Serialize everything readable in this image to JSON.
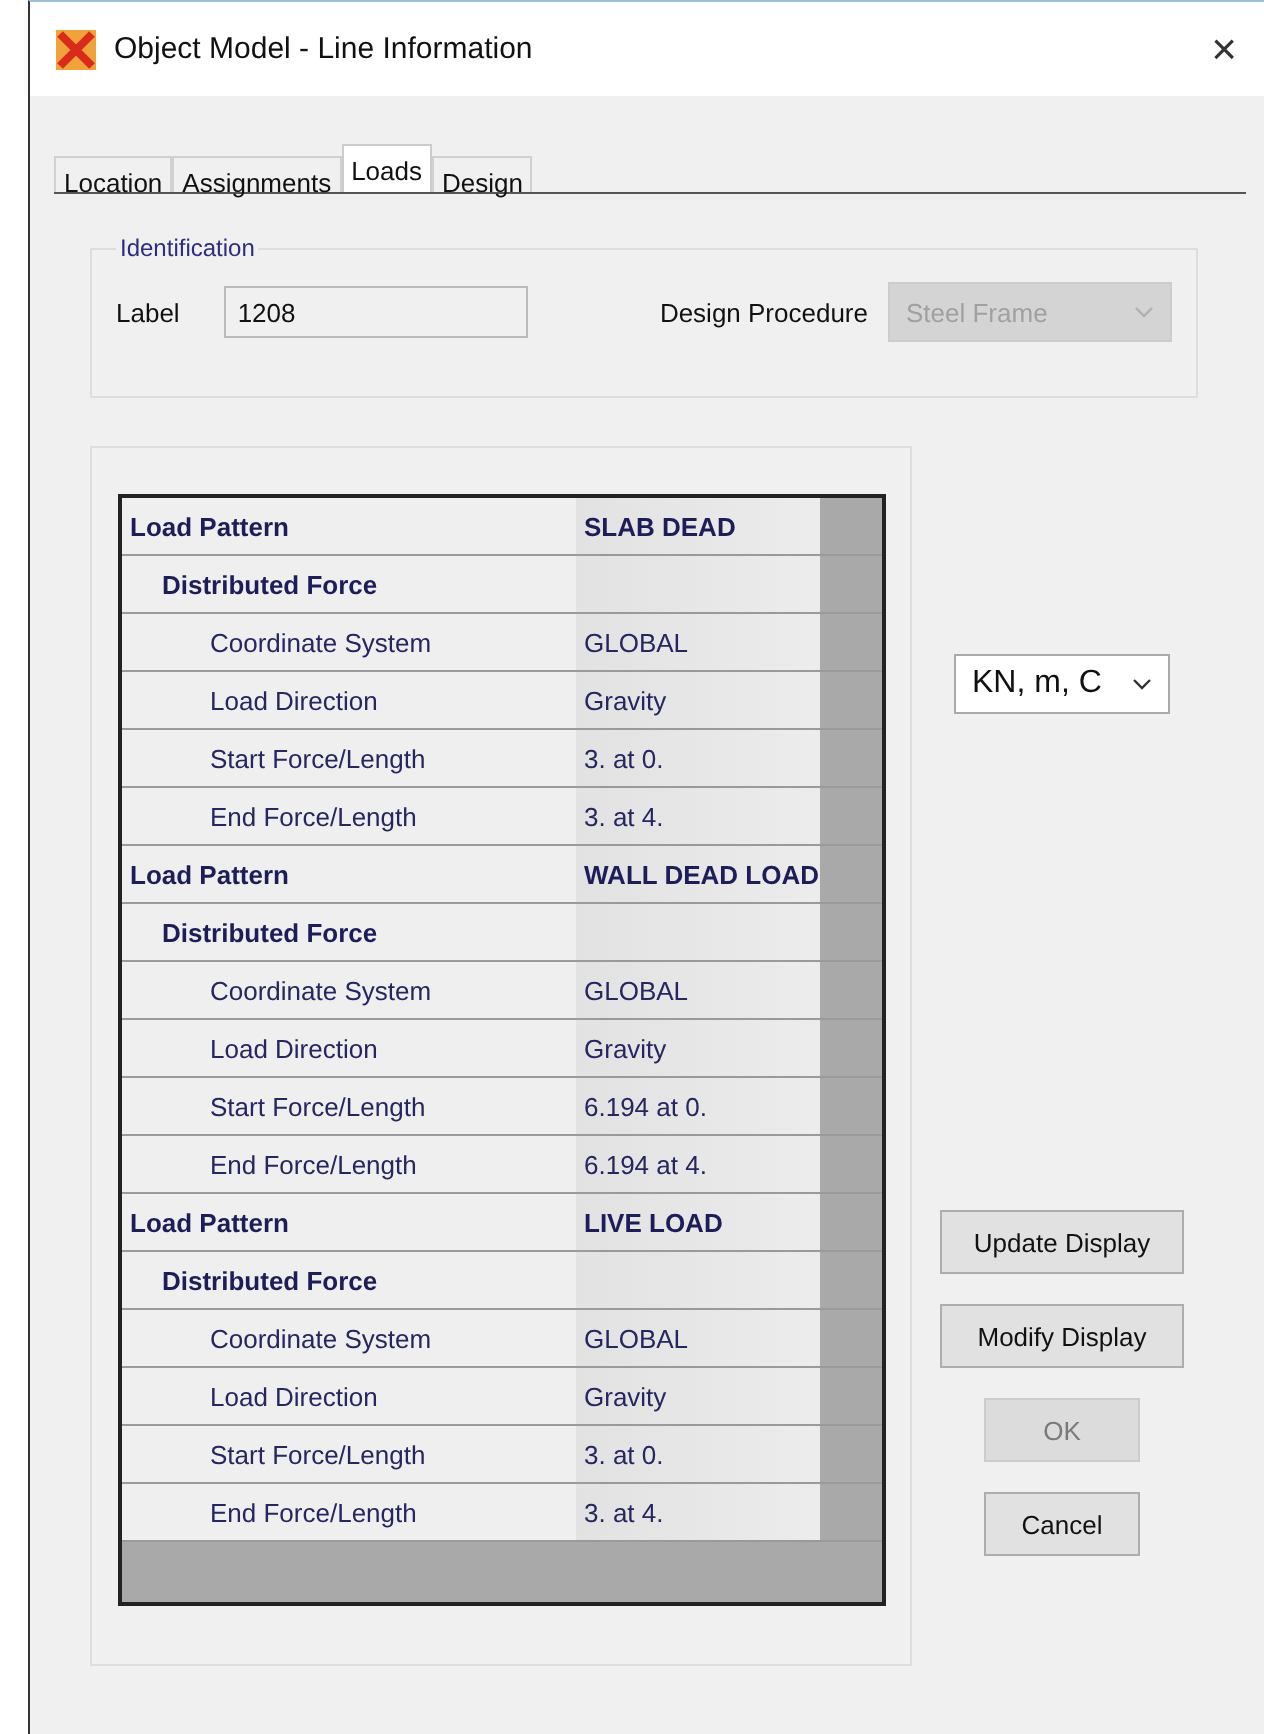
{
  "window": {
    "title": "Object Model - Line Information",
    "close": "×"
  },
  "tabs": [
    {
      "label": "Location",
      "selected": false
    },
    {
      "label": "Assignments",
      "selected": false
    },
    {
      "label": "Loads",
      "selected": true
    },
    {
      "label": "Design",
      "selected": false
    }
  ],
  "identification": {
    "title": "Identification",
    "label_caption": "Label",
    "label_value": "1208",
    "procedure_caption": "Design Procedure",
    "procedure_value": "Steel Frame",
    "procedure_disabled": true
  },
  "table": {
    "rows": [
      {
        "kind": "pattern",
        "label": "Load Pattern",
        "value": "SLAB DEAD"
      },
      {
        "kind": "group",
        "label": "Distributed Force",
        "value": ""
      },
      {
        "kind": "property",
        "label": "Coordinate System",
        "value": "GLOBAL"
      },
      {
        "kind": "property",
        "label": "Load Direction",
        "value": "Gravity"
      },
      {
        "kind": "property",
        "label": "Start Force/Length",
        "value": "3. at 0."
      },
      {
        "kind": "property",
        "label": "End Force/Length",
        "value": "3. at 4."
      },
      {
        "kind": "pattern",
        "label": "Load Pattern",
        "value": "WALL DEAD LOAD"
      },
      {
        "kind": "group",
        "label": "Distributed Force",
        "value": ""
      },
      {
        "kind": "property",
        "label": "Coordinate System",
        "value": "GLOBAL"
      },
      {
        "kind": "property",
        "label": "Load Direction",
        "value": "Gravity"
      },
      {
        "kind": "property",
        "label": "Start Force/Length",
        "value": "6.194 at 0."
      },
      {
        "kind": "property",
        "label": "End Force/Length",
        "value": "6.194 at 4."
      },
      {
        "kind": "pattern",
        "label": "Load Pattern",
        "value": "LIVE LOAD"
      },
      {
        "kind": "group",
        "label": "Distributed Force",
        "value": ""
      },
      {
        "kind": "property",
        "label": "Coordinate System",
        "value": "GLOBAL"
      },
      {
        "kind": "property",
        "label": "Load Direction",
        "value": "Gravity"
      },
      {
        "kind": "property",
        "label": "Start Force/Length",
        "value": "3. at 0."
      },
      {
        "kind": "property",
        "label": "End Force/Length",
        "value": "3. at 4."
      }
    ]
  },
  "units": {
    "value": "KN, m, C"
  },
  "buttons": [
    {
      "label": "Update Display",
      "kind": "wide",
      "disabled": false
    },
    {
      "label": "Modify Display",
      "kind": "wide",
      "disabled": false
    },
    {
      "label": "OK",
      "kind": "narrow",
      "disabled": true
    },
    {
      "label": "Cancel",
      "kind": "narrow",
      "disabled": false
    }
  ]
}
